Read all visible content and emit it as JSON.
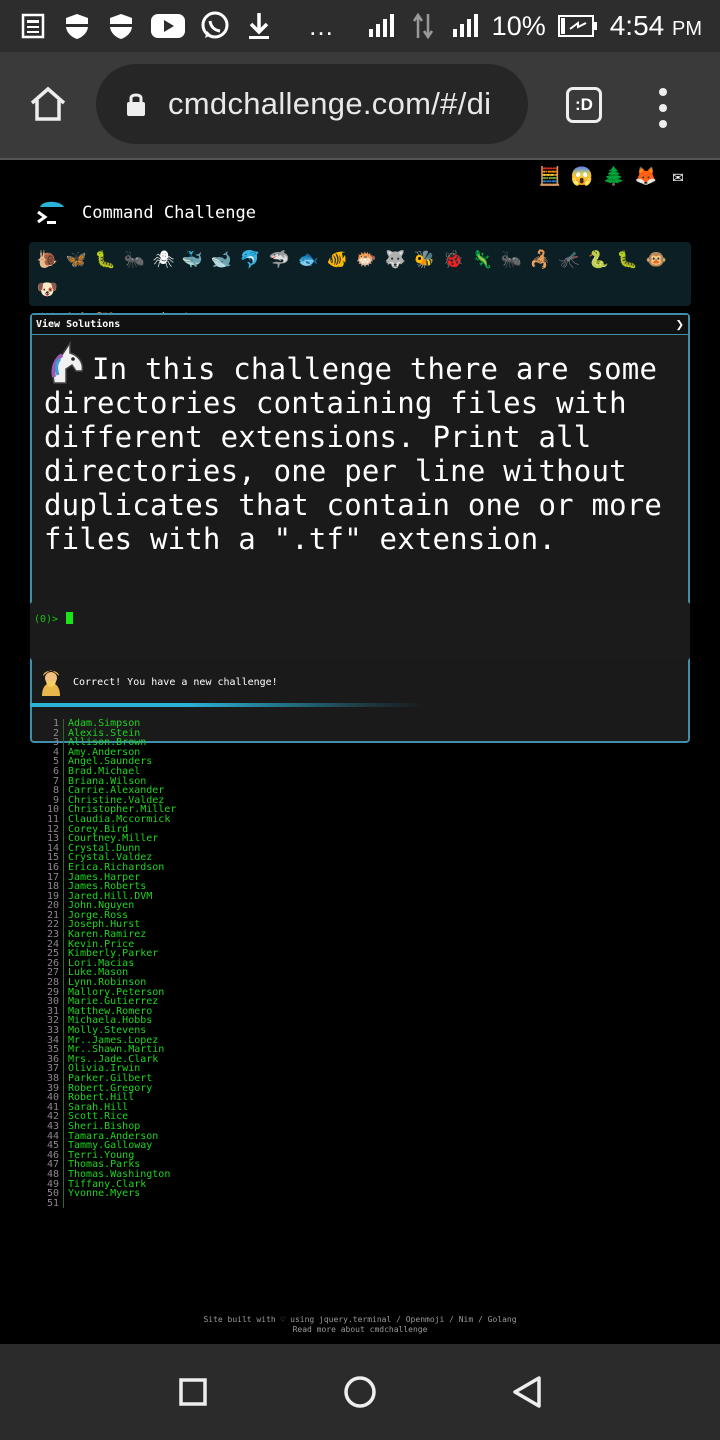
{
  "status_bar": {
    "battery": "10%",
    "time": "4:54",
    "ampm": "PM",
    "overflow": "…",
    "icons": [
      "news-icon",
      "shield-icon",
      "shield-icon",
      "youtube-icon",
      "whatsapp-icon",
      "download-icon",
      "signal-icon",
      "data-arrows-icon",
      "signal-icon",
      "battery-icon"
    ]
  },
  "browser": {
    "url": "cmdchallenge.com/#/di",
    "tabs_label": ":D"
  },
  "page": {
    "brand_title": "Command Challenge",
    "top_icons": [
      "🧮",
      "😱",
      "🌲",
      "🦊",
      "✉"
    ],
    "emoji_row1": [
      "🐌",
      "🦋",
      "🐛",
      "🐜",
      "🕷",
      "🐳",
      "🐋",
      "🐬",
      "🦈",
      "🐟",
      "🐠",
      "🐡",
      "🐺",
      "🐝",
      "🐞",
      "🦎",
      "🐜",
      "🦂",
      "🦟",
      "🐍",
      "🐛",
      "🐵",
      "🐶"
    ],
    "emoji_row2": [
      "🦊",
      "🐱",
      "🐯",
      "🐅",
      "🐴",
      "🦄"
    ],
    "view_solutions": "View Solutions",
    "challenge_text": "In this challenge there are some directories containing files with different extensions. Print all directories, one per line without duplicates that contain one or more files with a \".tf\" extension.",
    "prompt": "(0)>",
    "feedback": "Correct! You have a new challenge!",
    "output_lines": [
      "Adam.Simpson",
      "Alexis.Stein",
      "Allison.Brown",
      "Amy.Anderson",
      "Angel.Saunders",
      "Brad.Michael",
      "Briana.Wilson",
      "Carrie.Alexander",
      "Christine.Valdez",
      "Christopher.Miller",
      "Claudia.Mccormick",
      "Corey.Bird",
      "Courtney.Miller",
      "Crystal.Dunn",
      "Crystal.Valdez",
      "Erica.Richardson",
      "James.Harper",
      "James.Roberts",
      "Jared.Hill.DVM",
      "John.Nguyen",
      "Jorge.Ross",
      "Joseph.Hurst",
      "Karen.Ramirez",
      "Kevin.Price",
      "Kimberly.Parker",
      "Lori.Macias",
      "Luke.Mason",
      "Lynn.Robinson",
      "Mallory.Peterson",
      "Marie.Gutierrez",
      "Matthew.Romero",
      "Michaela.Hobbs",
      "Molly.Stevens",
      "Mr..James.Lopez",
      "Mr..Shawn.Martin",
      "Mrs..Jade.Clark",
      "Olivia.Irwin",
      "Parker.Gilbert",
      "Robert.Gregory",
      "Robert.Hill",
      "Sarah.Hill",
      "Scott.Rice",
      "Sheri.Bishop",
      "Tamara.Anderson",
      "Tammy.Galloway",
      "Terri.Young",
      "Thomas.Parks",
      "Thomas.Washington",
      "Tiffany.Clark",
      "Yvonne.Myers",
      ""
    ],
    "footer_line1": "Site built with ♡ using jquery.terminal / Openmoji / Nim / Golang",
    "footer_line2": "Read more about cmdchallenge"
  },
  "colors": {
    "accent": "#2ab3d6",
    "terminal_green": "#1ed61e",
    "panel_border": "#3f8fa8"
  }
}
